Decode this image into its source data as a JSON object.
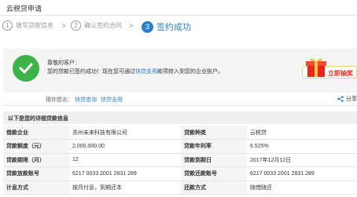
{
  "page": {
    "title": "云税贷申请"
  },
  "steps": [
    {
      "num": "1",
      "label": "填写贷款信息"
    },
    {
      "num": "2",
      "label": "确认签约合同"
    },
    {
      "num": "3",
      "label": "签约成功"
    }
  ],
  "step_arrow": ">",
  "notice": {
    "greeting": "尊敬的客户：",
    "msg_prefix": "您的贷款已签约成功！现在您可通过",
    "msg_link": "快贷支用",
    "msg_suffix": "款项转入到您的企业账户。"
  },
  "promo": {
    "label": "立即抽奖"
  },
  "interest": {
    "question": "猜你想去：",
    "links": [
      "快贷查询",
      "快贷支用"
    ],
    "share": "分享"
  },
  "details": {
    "title": "以下是您的详细贷款信息",
    "rows": [
      [
        "借款企业",
        "苏州未来科技有限公司",
        "贷款种类",
        "云税贷"
      ],
      [
        "贷款额度（元）",
        "2,000,000.00",
        "贷款年利率",
        "6.525%"
      ],
      [
        "贷款期限（月）",
        "12",
        "贷款到期日",
        "2017年12月12日"
      ],
      [
        "贷款放款账号",
        "6217 0033 2001 2831 289",
        "贷款还款账号",
        "6217 0033 2001 2831 289"
      ],
      [
        "计息方式",
        "按月付息，到期还本",
        "还款方式",
        "随借随还"
      ]
    ]
  },
  "colors": {
    "accent": "#2a80c9",
    "success": "#3db34a",
    "promo": "#e8261e"
  },
  "icons": {
    "success": "check-circle-icon",
    "share": "share-icon",
    "gift": "gift-box-icon"
  }
}
